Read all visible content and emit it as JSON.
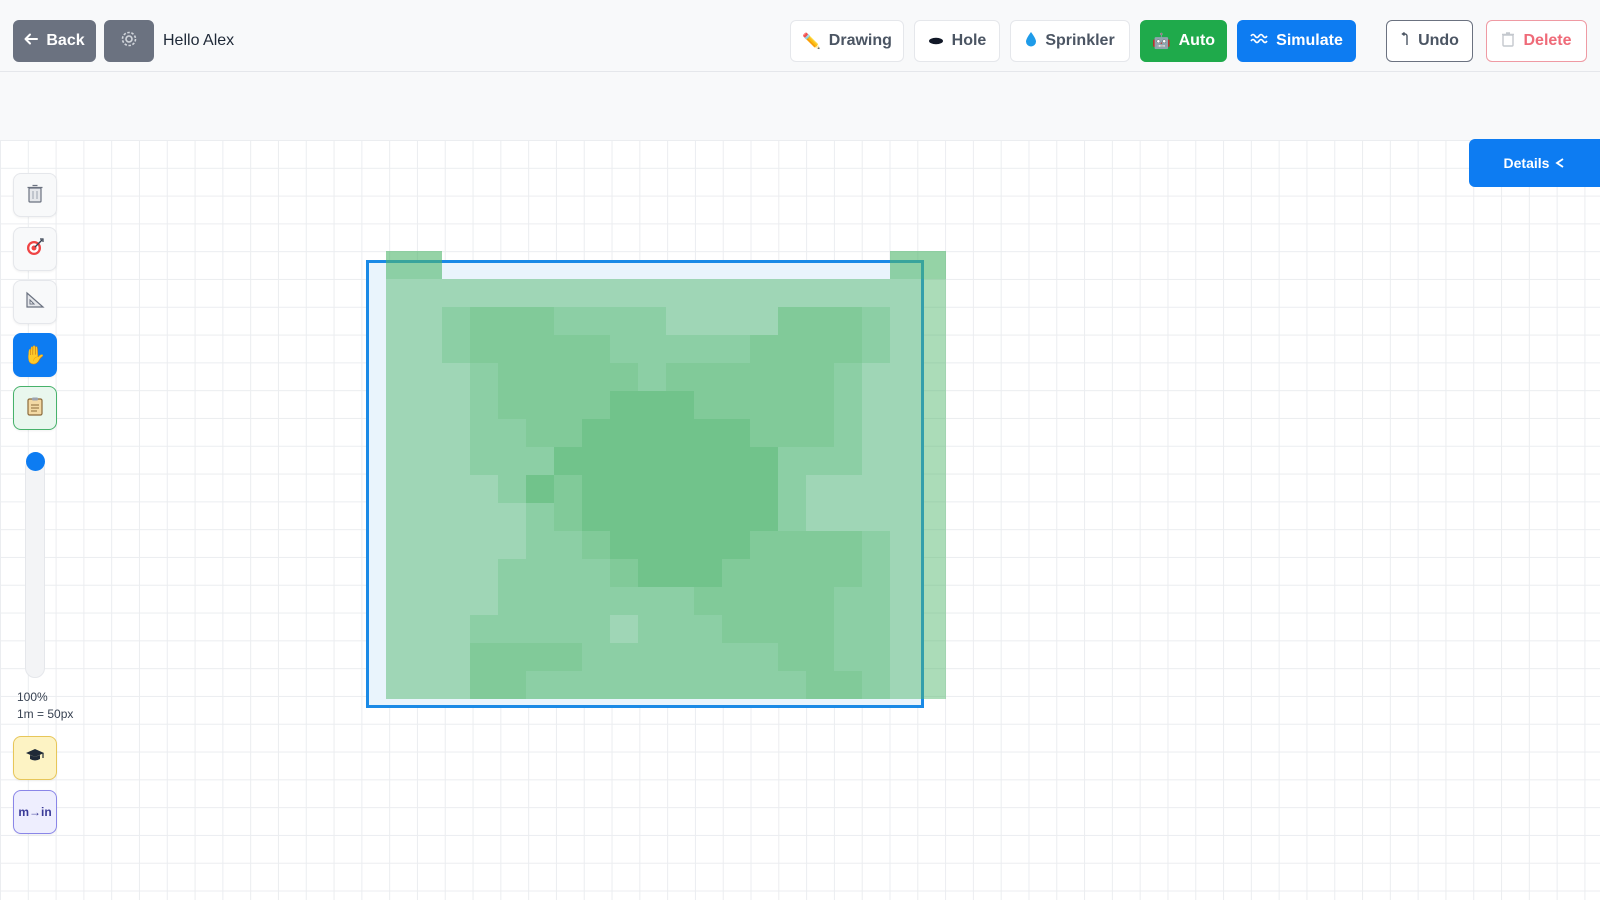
{
  "header": {
    "back_label": "Back",
    "greeting": "Hello Alex",
    "tools": {
      "drawing": "Drawing",
      "hole": "Hole",
      "sprinkler": "Sprinkler",
      "auto": "Auto",
      "simulate": "Simulate"
    },
    "undo_label": "Undo",
    "delete_label": "Delete"
  },
  "icons": {
    "back": "arrow-left",
    "settings": "gear",
    "drawing": "pencil",
    "hole": "hole",
    "sprinkler": "droplet",
    "auto": "robot",
    "simulate": "waves",
    "undo": "undo-arrow",
    "delete": "trash",
    "details": "chevron-left"
  },
  "details_panel": {
    "label": "Details"
  },
  "sidebar": {
    "tools": [
      {
        "name": "trash",
        "icon": "trash"
      },
      {
        "name": "target",
        "icon": "target"
      },
      {
        "name": "ruler",
        "icon": "triangle-ruler"
      },
      {
        "name": "pan",
        "icon": "hand",
        "active": true
      },
      {
        "name": "notes",
        "icon": "clipboard"
      }
    ],
    "zoom_percent": "100%",
    "scale_label": "1m = 50px",
    "tutorial_icon": "graduation-cap",
    "unit_toggle_label": "m→in"
  },
  "colors": {
    "primary": "#0d7cf2",
    "success": "#1faa4b",
    "danger": "#ef6a78",
    "area_border": "#1a8ae6",
    "coverage": "#4fb56a"
  },
  "coverage_grid": {
    "cols": 20,
    "rows": 16,
    "levels": [
      "44000000000000000044",
      "33333333333333333333",
      "33455544443333555433",
      "33455555444445555433",
      "33345555545555554333",
      "33345555666555554333",
      "33344556666665554333",
      "33344466666666444333",
      "33334656666666433333",
      "33333456666666433333",
      "33333445666665555433",
      "33334444566655555433",
      "33334444444555554433",
      "33344444344455554433",
      "33355554444444554433",
      "33355444444444455433"
    ]
  }
}
